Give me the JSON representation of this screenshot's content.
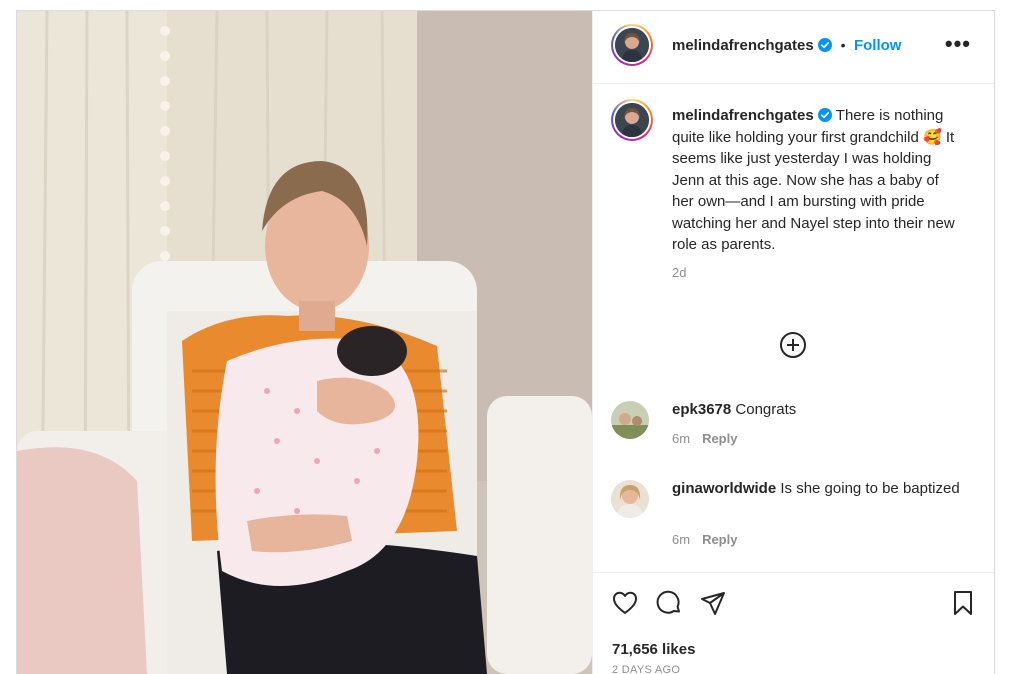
{
  "post": {
    "photo_alt": "Woman holding newborn baby",
    "header": {
      "username": "melindafrenchgates",
      "separator": "•",
      "follow_label": "Follow",
      "more_label": "•••"
    },
    "caption": {
      "username": "melindafrenchgates",
      "text_part1": "There is nothing quite like holding your first grandchild",
      "emoji": "🥰",
      "text_part2": "It seems like just yesterday I was holding Jenn at this age. Now she has a baby of her own—and I am bursting with pride watching her and Nayel step into their new role as parents.",
      "time": "2d"
    },
    "comments": [
      {
        "username": "epk3678",
        "text": "Congrats",
        "time": "6m",
        "reply_label": "Reply"
      },
      {
        "username": "ginaworldwide",
        "text": "Is she going to be baptized",
        "time": "6m",
        "reply_label": "Reply"
      }
    ],
    "likes": "71,656 likes",
    "posted_ago": "2 DAYS AGO",
    "icons": [
      "heart-icon",
      "comment-icon",
      "share-icon",
      "bookmark-icon",
      "add-circle-icon",
      "verified-badge-icon"
    ],
    "colors": {
      "link": "#0095f6",
      "verified": "#0095f6",
      "muted": "#8e8e8e",
      "text": "#262626"
    }
  }
}
